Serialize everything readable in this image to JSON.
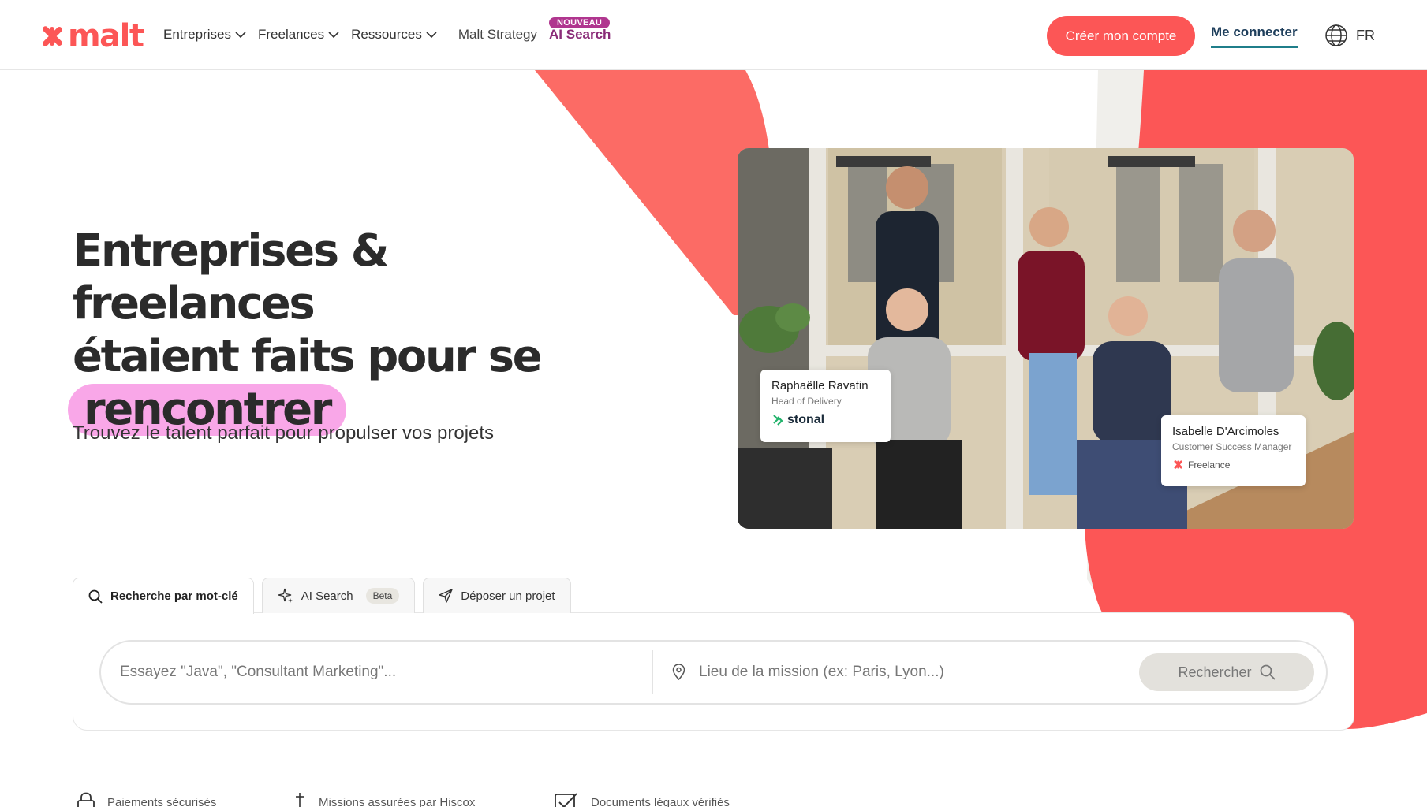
{
  "header": {
    "brand": "malt",
    "nav": [
      {
        "label": "Entreprises",
        "has_dropdown": true
      },
      {
        "label": "Freelances",
        "has_dropdown": true
      },
      {
        "label": "Ressources",
        "has_dropdown": true
      }
    ],
    "strategy_label": "Malt Strategy",
    "ai_search": {
      "badge": "NOUVEAU",
      "label": "AI Search"
    },
    "create_account": "Créer mon compte",
    "login": "Me connecter",
    "language": "FR"
  },
  "hero": {
    "title_line1": "Entreprises & freelances",
    "title_line2": "étaient faits pour se",
    "title_highlight": "rencontrer",
    "subtitle": "Trouvez le talent parfait pour propulser vos projets"
  },
  "photo_cards": [
    {
      "name": "Raphaëlle Ravatin",
      "role": "Head of Delivery",
      "company": "stonal"
    },
    {
      "name": "Isabelle D'Arcimoles",
      "role": "Customer Success Manager",
      "company": "Freelance"
    }
  ],
  "search": {
    "tabs": [
      {
        "label": "Recherche par mot-clé",
        "active": true
      },
      {
        "label": "AI Search",
        "badge": "Beta",
        "active": false
      },
      {
        "label": "Déposer un projet",
        "active": false
      }
    ],
    "keyword_placeholder": "Essayez \"Java\", \"Consultant Marketing\"...",
    "location_placeholder": "Lieu de la mission (ex: Paris, Lyon...)",
    "button": "Rechercher"
  },
  "trust": [
    {
      "icon": "lock-icon",
      "label": "Paiements sécurisés"
    },
    {
      "icon": "anchor-icon",
      "label": "Missions assurées par Hiscox"
    },
    {
      "icon": "checkbox-icon",
      "label": "Documents légaux vérifiés"
    }
  ],
  "colors": {
    "brand": "#fc5656",
    "highlight": "#f9a7e8",
    "ai_accent": "#b0368f"
  }
}
